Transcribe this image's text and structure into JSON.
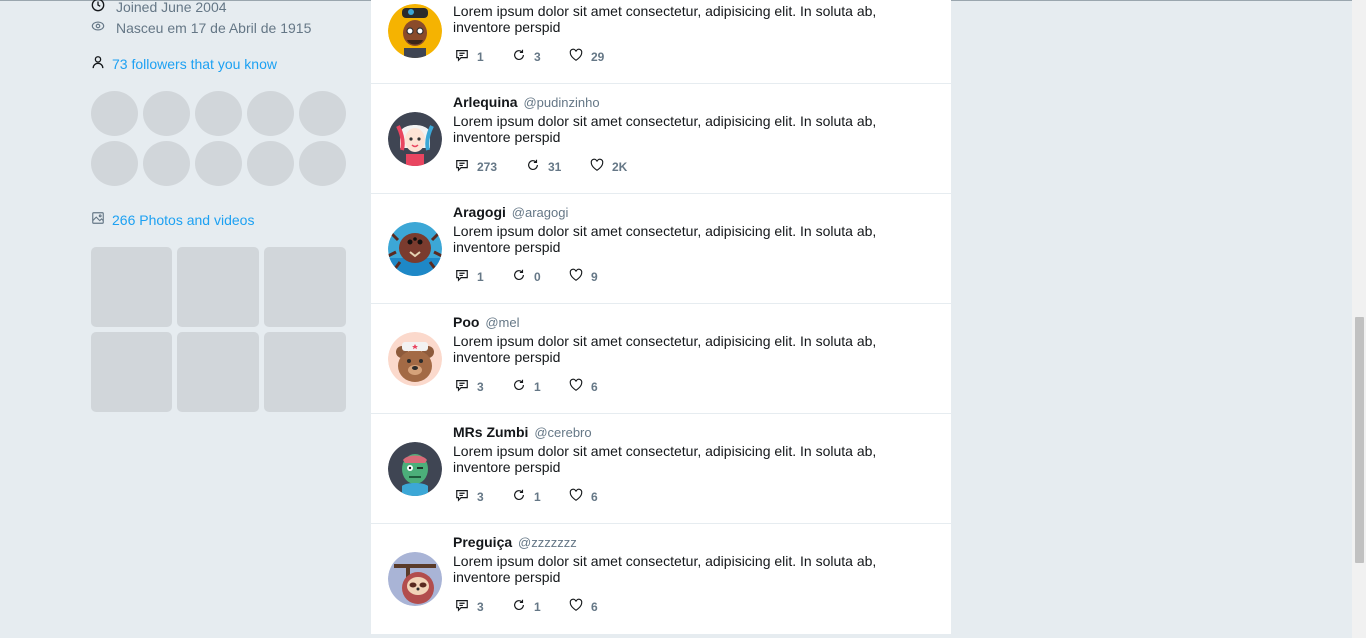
{
  "profile": {
    "joined": "Joined June 2004",
    "birth": "Nasceu em 17 de Abril de 1915",
    "followers_link": "73 followers that you know",
    "photos_link": "266 Photos and videos"
  },
  "tweets": [
    {
      "name": "",
      "handle": "",
      "text": "Lorem ipsum dolor sit amet consectetur, adipisicing elit. In soluta ab, inventore perspid",
      "replies": "1",
      "retweets": "3",
      "likes": "29",
      "avatar": "boy-with-cap-avatar"
    },
    {
      "name": "Arlequina",
      "handle": "@pudinzinho",
      "text": "Lorem ipsum dolor sit amet consectetur, adipisicing elit. In soluta ab, inventore perspid",
      "replies": "273",
      "retweets": "31",
      "likes": "2K",
      "avatar": "harley-avatar"
    },
    {
      "name": "Aragogi",
      "handle": "@aragogi",
      "text": "Lorem ipsum dolor sit amet consectetur, adipisicing elit. In soluta ab, inventore perspid",
      "replies": "1",
      "retweets": "0",
      "likes": "9",
      "avatar": "spider-avatar"
    },
    {
      "name": "Poo",
      "handle": "@mel",
      "text": "Lorem ipsum dolor sit amet consectetur, adipisicing elit. In soluta ab, inventore perspid",
      "replies": "3",
      "retweets": "1",
      "likes": "6",
      "avatar": "bear-avatar"
    },
    {
      "name": "MRs Zumbi",
      "handle": "@cerebro",
      "text": "Lorem ipsum dolor sit amet consectetur, adipisicing elit. In soluta ab, inventore perspid",
      "replies": "3",
      "retweets": "1",
      "likes": "6",
      "avatar": "zombie-avatar"
    },
    {
      "name": "Preguiça",
      "handle": "@zzzzzzz",
      "text": "Lorem ipsum dolor sit amet consectetur, adipisicing elit. In soluta ab, inventore perspid",
      "replies": "3",
      "retweets": "1",
      "likes": "6",
      "avatar": "sloth-avatar"
    }
  ],
  "colors": {
    "accent": "#1da1f2",
    "muted": "#657786",
    "background": "#e6ecf0"
  }
}
